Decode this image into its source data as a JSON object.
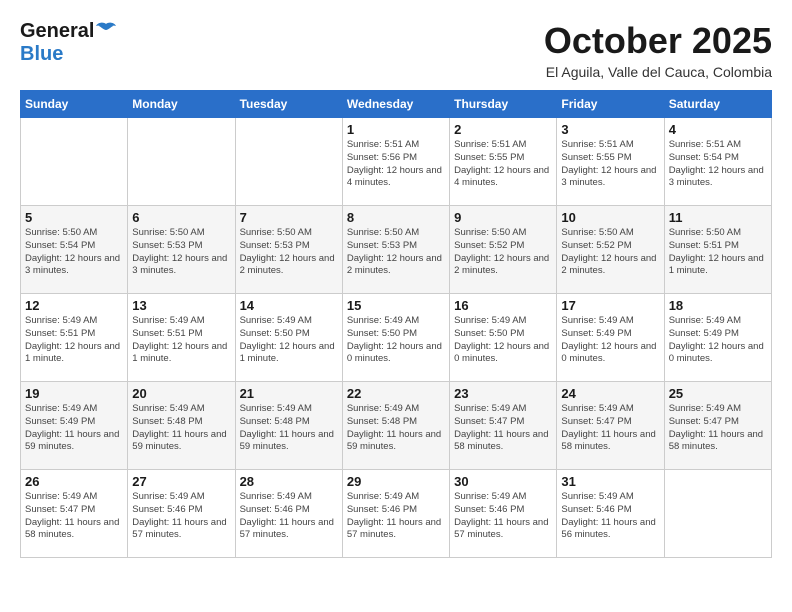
{
  "header": {
    "logo_general": "General",
    "logo_blue": "Blue",
    "month_year": "October 2025",
    "location": "El Aguila, Valle del Cauca, Colombia"
  },
  "days_of_week": [
    "Sunday",
    "Monday",
    "Tuesday",
    "Wednesday",
    "Thursday",
    "Friday",
    "Saturday"
  ],
  "weeks": [
    [
      {
        "day": "",
        "info": ""
      },
      {
        "day": "",
        "info": ""
      },
      {
        "day": "",
        "info": ""
      },
      {
        "day": "1",
        "info": "Sunrise: 5:51 AM\nSunset: 5:56 PM\nDaylight: 12 hours\nand 4 minutes."
      },
      {
        "day": "2",
        "info": "Sunrise: 5:51 AM\nSunset: 5:55 PM\nDaylight: 12 hours\nand 4 minutes."
      },
      {
        "day": "3",
        "info": "Sunrise: 5:51 AM\nSunset: 5:55 PM\nDaylight: 12 hours\nand 3 minutes."
      },
      {
        "day": "4",
        "info": "Sunrise: 5:51 AM\nSunset: 5:54 PM\nDaylight: 12 hours\nand 3 minutes."
      }
    ],
    [
      {
        "day": "5",
        "info": "Sunrise: 5:50 AM\nSunset: 5:54 PM\nDaylight: 12 hours\nand 3 minutes."
      },
      {
        "day": "6",
        "info": "Sunrise: 5:50 AM\nSunset: 5:53 PM\nDaylight: 12 hours\nand 3 minutes."
      },
      {
        "day": "7",
        "info": "Sunrise: 5:50 AM\nSunset: 5:53 PM\nDaylight: 12 hours\nand 2 minutes."
      },
      {
        "day": "8",
        "info": "Sunrise: 5:50 AM\nSunset: 5:53 PM\nDaylight: 12 hours\nand 2 minutes."
      },
      {
        "day": "9",
        "info": "Sunrise: 5:50 AM\nSunset: 5:52 PM\nDaylight: 12 hours\nand 2 minutes."
      },
      {
        "day": "10",
        "info": "Sunrise: 5:50 AM\nSunset: 5:52 PM\nDaylight: 12 hours\nand 2 minutes."
      },
      {
        "day": "11",
        "info": "Sunrise: 5:50 AM\nSunset: 5:51 PM\nDaylight: 12 hours\nand 1 minute."
      }
    ],
    [
      {
        "day": "12",
        "info": "Sunrise: 5:49 AM\nSunset: 5:51 PM\nDaylight: 12 hours\nand 1 minute."
      },
      {
        "day": "13",
        "info": "Sunrise: 5:49 AM\nSunset: 5:51 PM\nDaylight: 12 hours\nand 1 minute."
      },
      {
        "day": "14",
        "info": "Sunrise: 5:49 AM\nSunset: 5:50 PM\nDaylight: 12 hours\nand 1 minute."
      },
      {
        "day": "15",
        "info": "Sunrise: 5:49 AM\nSunset: 5:50 PM\nDaylight: 12 hours\nand 0 minutes."
      },
      {
        "day": "16",
        "info": "Sunrise: 5:49 AM\nSunset: 5:50 PM\nDaylight: 12 hours\nand 0 minutes."
      },
      {
        "day": "17",
        "info": "Sunrise: 5:49 AM\nSunset: 5:49 PM\nDaylight: 12 hours\nand 0 minutes."
      },
      {
        "day": "18",
        "info": "Sunrise: 5:49 AM\nSunset: 5:49 PM\nDaylight: 12 hours\nand 0 minutes."
      }
    ],
    [
      {
        "day": "19",
        "info": "Sunrise: 5:49 AM\nSunset: 5:49 PM\nDaylight: 11 hours\nand 59 minutes."
      },
      {
        "day": "20",
        "info": "Sunrise: 5:49 AM\nSunset: 5:48 PM\nDaylight: 11 hours\nand 59 minutes."
      },
      {
        "day": "21",
        "info": "Sunrise: 5:49 AM\nSunset: 5:48 PM\nDaylight: 11 hours\nand 59 minutes."
      },
      {
        "day": "22",
        "info": "Sunrise: 5:49 AM\nSunset: 5:48 PM\nDaylight: 11 hours\nand 59 minutes."
      },
      {
        "day": "23",
        "info": "Sunrise: 5:49 AM\nSunset: 5:47 PM\nDaylight: 11 hours\nand 58 minutes."
      },
      {
        "day": "24",
        "info": "Sunrise: 5:49 AM\nSunset: 5:47 PM\nDaylight: 11 hours\nand 58 minutes."
      },
      {
        "day": "25",
        "info": "Sunrise: 5:49 AM\nSunset: 5:47 PM\nDaylight: 11 hours\nand 58 minutes."
      }
    ],
    [
      {
        "day": "26",
        "info": "Sunrise: 5:49 AM\nSunset: 5:47 PM\nDaylight: 11 hours\nand 58 minutes."
      },
      {
        "day": "27",
        "info": "Sunrise: 5:49 AM\nSunset: 5:46 PM\nDaylight: 11 hours\nand 57 minutes."
      },
      {
        "day": "28",
        "info": "Sunrise: 5:49 AM\nSunset: 5:46 PM\nDaylight: 11 hours\nand 57 minutes."
      },
      {
        "day": "29",
        "info": "Sunrise: 5:49 AM\nSunset: 5:46 PM\nDaylight: 11 hours\nand 57 minutes."
      },
      {
        "day": "30",
        "info": "Sunrise: 5:49 AM\nSunset: 5:46 PM\nDaylight: 11 hours\nand 57 minutes."
      },
      {
        "day": "31",
        "info": "Sunrise: 5:49 AM\nSunset: 5:46 PM\nDaylight: 11 hours\nand 56 minutes."
      },
      {
        "day": "",
        "info": ""
      }
    ]
  ]
}
